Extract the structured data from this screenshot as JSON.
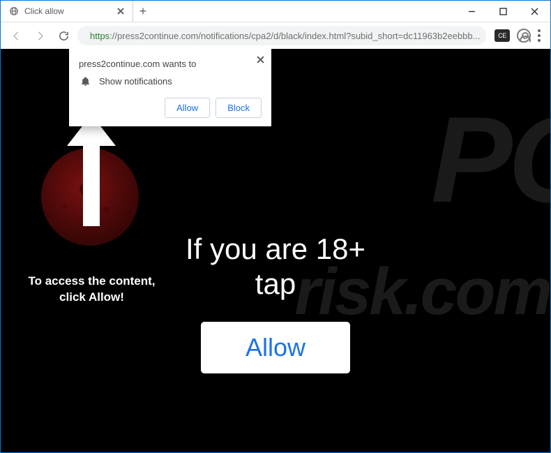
{
  "window": {
    "tab_title": "Click allow",
    "url_prefix": "https",
    "url_rest": "://press2continue.com/notifications/cpa2/d/black/index.html?subid_short=dc11963b2eebbb...",
    "ext_badge": "CE"
  },
  "permission": {
    "title": "press2continue.com wants to",
    "item": "Show notifications",
    "allow": "Allow",
    "block": "Block"
  },
  "page": {
    "caption_line1": "To access the content,",
    "caption_line2": "click Allow!",
    "headline_line1": "If you are 18+",
    "headline_line2": "tap",
    "allow_button": "Allow"
  },
  "watermark": {
    "line1": "PC",
    "line2": "risk.com"
  }
}
